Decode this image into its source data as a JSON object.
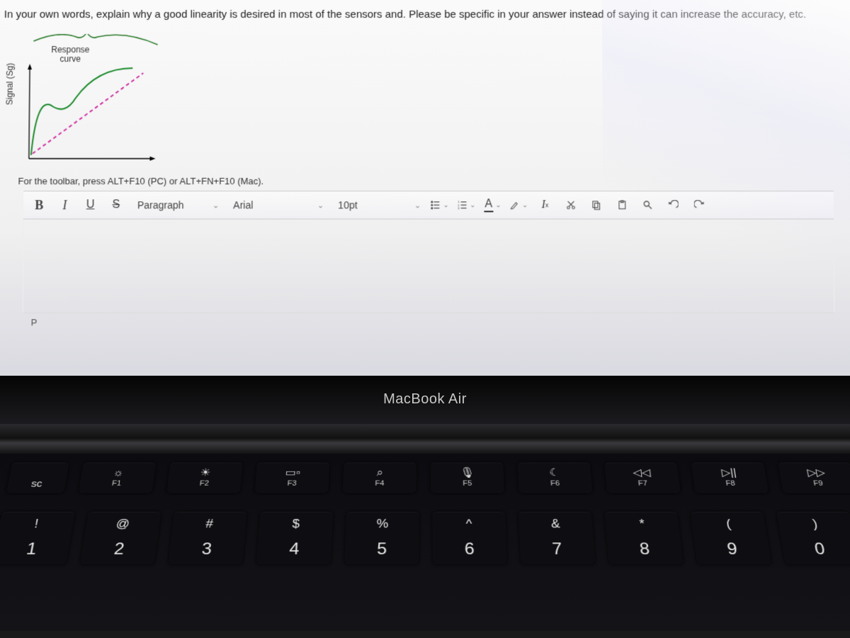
{
  "question": "In your own words, explain why a good linearity is desired in most of the sensors and. Please be specific in your answer instead of saying it can increase the accuracy, etc.",
  "chart": {
    "y_axis_label": "Signal (Sg)",
    "annotation_line1": "Response",
    "annotation_line2": "curve"
  },
  "toolbar_hint": "For the toolbar, press ALT+F10 (PC) or ALT+FN+F10 (Mac).",
  "toolbar": {
    "bold": "B",
    "italic": "I",
    "underline": "U",
    "strike": "S",
    "block_format": "Paragraph",
    "font_family": "Arial",
    "font_size": "10pt",
    "text_color": "A",
    "clear_format": "I",
    "clear_x": "x"
  },
  "editor_status": "P",
  "laptop": {
    "brand": "MacBook Air",
    "esc": "sc",
    "fn_keys": [
      {
        "icon": "brightness-low-icon",
        "glyph": "☼",
        "label": "F1"
      },
      {
        "icon": "brightness-high-icon",
        "glyph": "☀",
        "label": "F2"
      },
      {
        "icon": "mission-control-icon",
        "glyph": "▭▫",
        "label": "F3"
      },
      {
        "icon": "search-icon",
        "glyph": "⌕",
        "label": "F4"
      },
      {
        "icon": "mic-icon",
        "glyph": "🎙",
        "label": "F5"
      },
      {
        "icon": "dnd-icon",
        "glyph": "☾",
        "label": "F6"
      },
      {
        "icon": "rewind-icon",
        "glyph": "◁◁",
        "label": "F7"
      },
      {
        "icon": "play-pause-icon",
        "glyph": "▷||",
        "label": "F8"
      },
      {
        "icon": "forward-icon",
        "glyph": "▷▷",
        "label": "F9"
      }
    ],
    "num_keys": [
      {
        "top": "!",
        "bot": "1"
      },
      {
        "top": "@",
        "bot": "2"
      },
      {
        "top": "#",
        "bot": "3"
      },
      {
        "top": "$",
        "bot": "4"
      },
      {
        "top": "%",
        "bot": "5"
      },
      {
        "top": "^",
        "bot": "6"
      },
      {
        "top": "&",
        "bot": "7"
      },
      {
        "top": "*",
        "bot": "8"
      },
      {
        "top": "(",
        "bot": "9"
      },
      {
        "top": ")",
        "bot": "0"
      }
    ]
  }
}
